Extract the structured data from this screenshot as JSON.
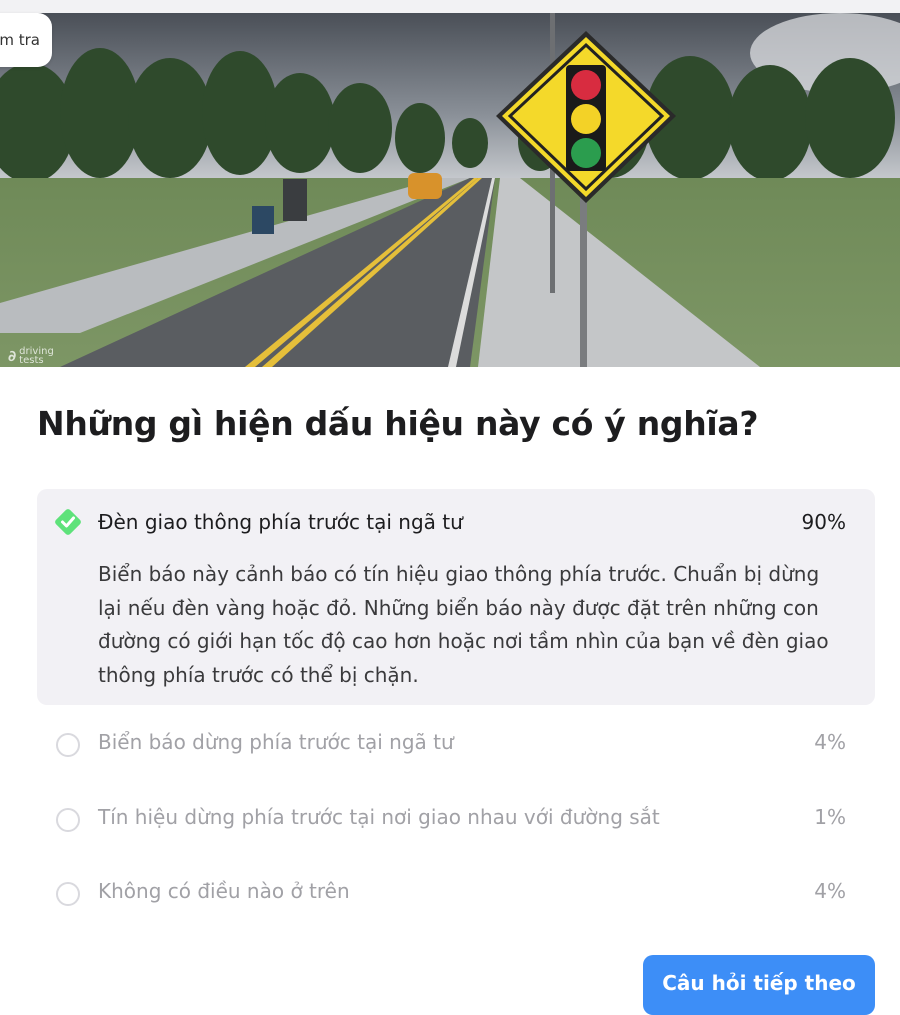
{
  "header": {
    "pill_text": "m tra"
  },
  "hero": {
    "watermark": {
      "line1": "driving",
      "line2": "tests"
    }
  },
  "question": {
    "title": "Những gì hiện dấu hiệu này có ý nghĩa?"
  },
  "answers": [
    {
      "label": "Đèn giao thông phía trước tại ngã tư",
      "percent": "90%",
      "correct": true,
      "explanation": "Biển báo này cảnh báo có tín hiệu giao thông phía trước. Chuẩn bị dừng lại nếu đèn vàng hoặc đỏ. Những biển báo này được đặt trên những con đường có giới hạn tốc độ cao hơn hoặc nơi tầm nhìn của bạn về đèn giao thông phía trước có thể bị chặn."
    },
    {
      "label": "Biển báo dừng phía trước tại ngã tư",
      "percent": "4%"
    },
    {
      "label": "Tín hiệu dừng phía trước tại nơi giao nhau với đường sắt",
      "percent": "1%"
    },
    {
      "label": "Không có điều nào ở trên",
      "percent": "4%"
    }
  ],
  "actions": {
    "next_label": "Câu hỏi tiếp theo"
  },
  "colors": {
    "accent": "#3d8ef7",
    "correct": "#5ee27a",
    "sign_yellow": "#f4d92a"
  }
}
